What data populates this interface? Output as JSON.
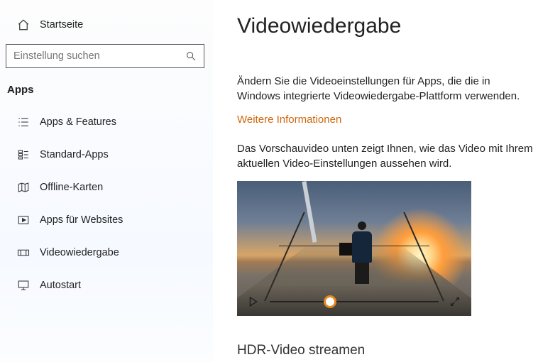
{
  "sidebar": {
    "home_label": "Startseite",
    "search_placeholder": "Einstellung suchen",
    "section_header": "Apps",
    "items": [
      {
        "label": "Apps & Features"
      },
      {
        "label": "Standard-Apps"
      },
      {
        "label": "Offline-Karten"
      },
      {
        "label": "Apps für Websites"
      },
      {
        "label": "Videowiedergabe"
      },
      {
        "label": "Autostart"
      }
    ]
  },
  "main": {
    "title": "Videowiedergabe",
    "intro": "Ändern Sie die Videoeinstellungen für Apps, die die in Windows integrierte Videowiedergabe-Plattform verwenden.",
    "more_info": "Weitere Informationen",
    "preview_text": "Das Vorschauvideo unten zeigt Ihnen, wie das Video mit Ihrem aktuellen Video-Einstellungen aussehen wird.",
    "hdr_heading": "HDR-Video streamen"
  }
}
